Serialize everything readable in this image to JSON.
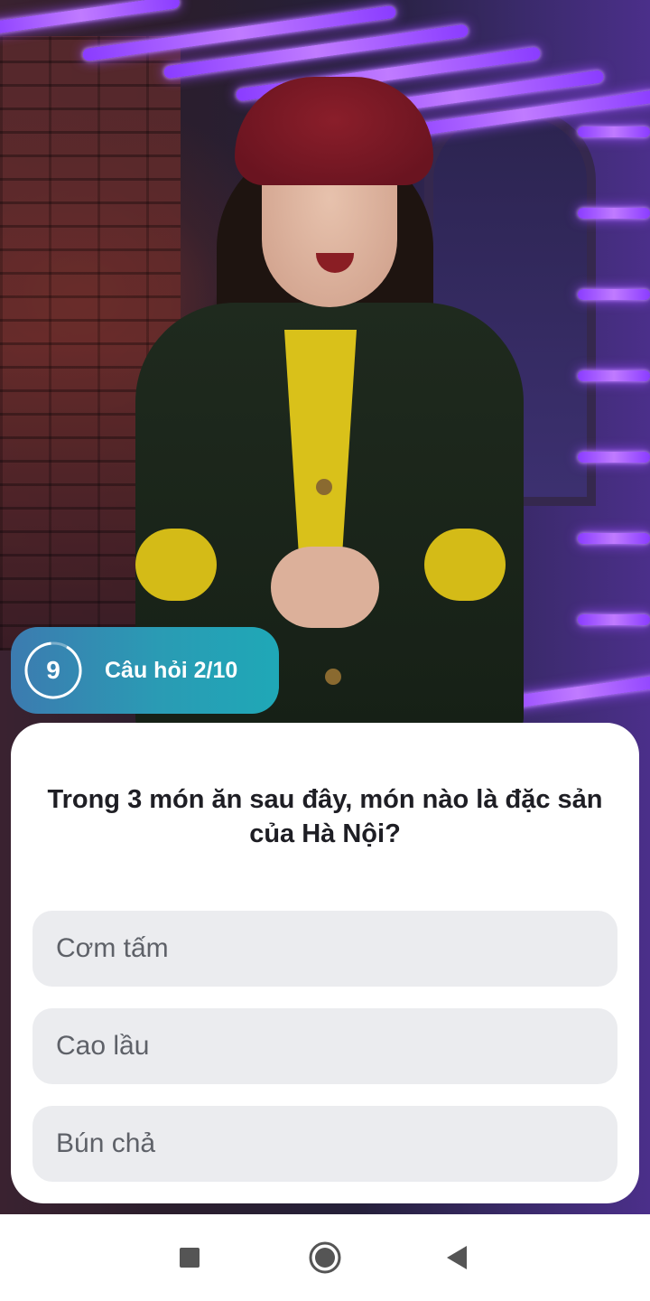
{
  "quiz": {
    "timer_value": "9",
    "question_counter": "Câu hỏi 2/10",
    "question": "Trong 3 món ăn sau đây, món nào là đặc sản của Hà Nội?",
    "options": [
      {
        "label": "Cơm tấm"
      },
      {
        "label": "Cao lầu"
      },
      {
        "label": "Bún chả"
      }
    ]
  },
  "navbar": {
    "icons": [
      "recents-square-icon",
      "home-circle-icon",
      "back-triangle-icon"
    ]
  },
  "colors": {
    "badge_start": "#3c7bb0",
    "badge_end": "#1fa8b7",
    "option_bg": "#ebecef",
    "option_text": "#5e6168",
    "question_text": "#1e1e24"
  }
}
